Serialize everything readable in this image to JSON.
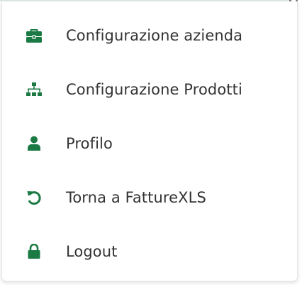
{
  "theme": {
    "accent": "#1b7a43",
    "text": "#333333"
  },
  "corner_text": "g",
  "menu": {
    "items": [
      {
        "label": "Configurazione azienda",
        "icon": "briefcase-icon"
      },
      {
        "label": "Configurazione Prodotti",
        "icon": "sitemap-icon"
      },
      {
        "label": "Profilo",
        "icon": "user-icon"
      },
      {
        "label": "Torna a FattureXLS",
        "icon": "undo-icon"
      },
      {
        "label": "Logout",
        "icon": "lock-icon"
      }
    ]
  }
}
